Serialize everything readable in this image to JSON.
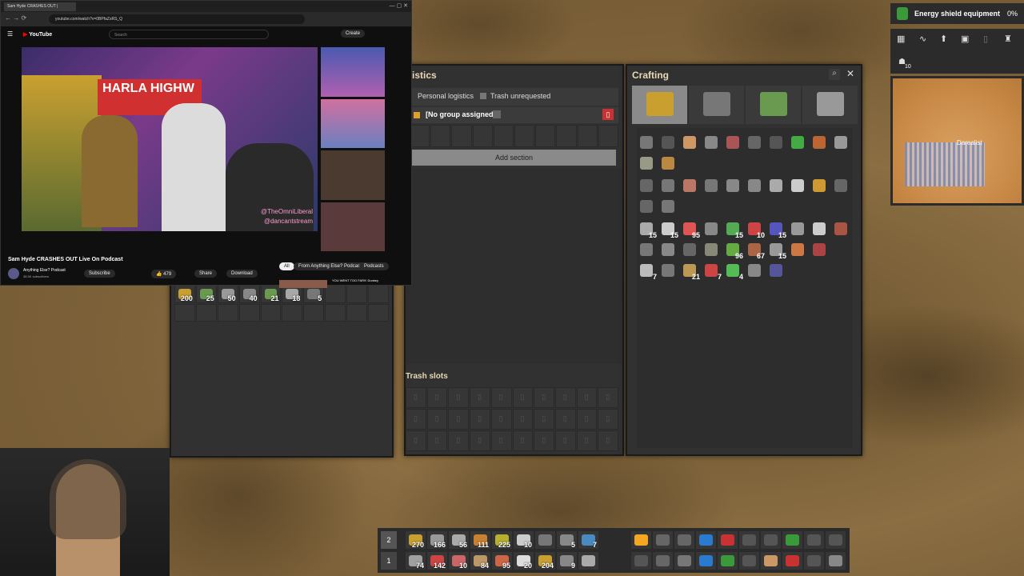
{
  "browser": {
    "tab": "Sam Hyde CRASHES OUT |",
    "url": "youtube.com/watch?v=0BPfaZsRS_Q"
  },
  "youtube": {
    "logo": "YouTube",
    "search_placeholder": "Search",
    "create": "Create",
    "video_title": "Sam Hyde CRASHES OUT Live On Podcast",
    "channel": "Anything Else? Podcast",
    "subs": "38.5K subscribers",
    "subscribe": "Subscribe",
    "likes": "479",
    "share": "Share",
    "download": "Download",
    "chips": [
      "All",
      "From Anything Else? Podcast",
      "Podcasts"
    ],
    "overlay_handle1": "@TheOmniLiberal",
    "overlay_handle2": "@dancantstream",
    "sign": "HARLA HIGHW",
    "rec_title": "YOU WENT TOO FAR!!! Dunkey"
  },
  "logistics": {
    "title": "istics",
    "personal": "Personal logistics",
    "trash_unrequested": "Trash unrequested",
    "group": "[No group assigned]",
    "add_section": "Add section",
    "trash_slots": "Trash slots"
  },
  "inventory_counts": [
    "200",
    "25",
    "50",
    "40",
    "21",
    "18",
    "5"
  ],
  "crafting": {
    "title": "Crafting",
    "rows": [
      [
        {
          "c": "#777",
          "n": ""
        },
        {
          "c": "#555",
          "n": ""
        },
        {
          "c": "#c96",
          "n": ""
        },
        {
          "c": "#888",
          "n": ""
        },
        {
          "c": "#a55",
          "n": ""
        },
        {
          "c": "#666",
          "n": ""
        },
        {
          "c": "#555",
          "n": ""
        },
        {
          "c": "#4a4",
          "n": ""
        },
        {
          "c": "#b63",
          "n": ""
        },
        {
          "c": "#999",
          "n": ""
        }
      ],
      [
        {
          "c": "#998",
          "n": ""
        },
        {
          "c": "#b84",
          "n": ""
        }
      ],
      [
        {
          "c": "#666",
          "n": ""
        },
        {
          "c": "#777",
          "n": ""
        },
        {
          "c": "#b76",
          "n": ""
        },
        {
          "c": "#777",
          "n": ""
        },
        {
          "c": "#888",
          "n": ""
        },
        {
          "c": "#888",
          "n": ""
        },
        {
          "c": "#aaa",
          "n": ""
        },
        {
          "c": "#ccc",
          "n": ""
        },
        {
          "c": "#c93",
          "n": ""
        },
        {
          "c": "#666",
          "n": ""
        }
      ],
      [
        {
          "c": "#666",
          "n": ""
        },
        {
          "c": "#777",
          "n": ""
        }
      ],
      [
        {
          "c": "#aaa",
          "n": "15"
        },
        {
          "c": "#ccc",
          "n": "15"
        },
        {
          "c": "#d55",
          "n": "95"
        },
        {
          "c": "#888",
          "n": ""
        },
        {
          "c": "#5a5",
          "n": "15"
        },
        {
          "c": "#c44",
          "n": "10"
        },
        {
          "c": "#55b",
          "n": "15"
        },
        {
          "c": "#999",
          "n": ""
        },
        {
          "c": "#ccc",
          "n": ""
        },
        {
          "c": "#a54",
          "n": ""
        }
      ],
      [
        {
          "c": "#777",
          "n": ""
        },
        {
          "c": "#888",
          "n": ""
        },
        {
          "c": "#666",
          "n": ""
        },
        {
          "c": "#887",
          "n": ""
        },
        {
          "c": "#6a4",
          "n": "96"
        },
        {
          "c": "#a64",
          "n": "67"
        },
        {
          "c": "#999",
          "n": "15"
        },
        {
          "c": "#c74",
          "n": ""
        },
        {
          "c": "#a44",
          "n": ""
        }
      ],
      [
        {
          "c": "#bbb",
          "n": "7"
        },
        {
          "c": "#777",
          "n": ""
        },
        {
          "c": "#b95",
          "n": "21"
        },
        {
          "c": "#c44",
          "n": "7"
        },
        {
          "c": "#5b5",
          "n": "4"
        },
        {
          "c": "#888",
          "n": ""
        },
        {
          "c": "#559",
          "n": ""
        }
      ]
    ]
  },
  "minimap": {
    "label": "Energy shield equipment",
    "pct": "0%",
    "place": "Darealist",
    "count": "10"
  },
  "hotbar": {
    "row2": "2",
    "row1": "1",
    "top": [
      "270",
      "166",
      "56",
      "111",
      "225",
      "10",
      "",
      "5",
      "7"
    ],
    "bottom": [
      "74",
      "142",
      "10",
      "84",
      "95",
      "20",
      "204",
      "9",
      ""
    ],
    "right_top": [
      "",
      "",
      "",
      "",
      "",
      "",
      "",
      "",
      "",
      ""
    ],
    "right_bottom": [
      "",
      "",
      "",
      "",
      "",
      "",
      "",
      "",
      "",
      ""
    ]
  },
  "colors": {
    "accent": "#f5a623",
    "red": "#c83232",
    "ytred": "#ff0000"
  }
}
